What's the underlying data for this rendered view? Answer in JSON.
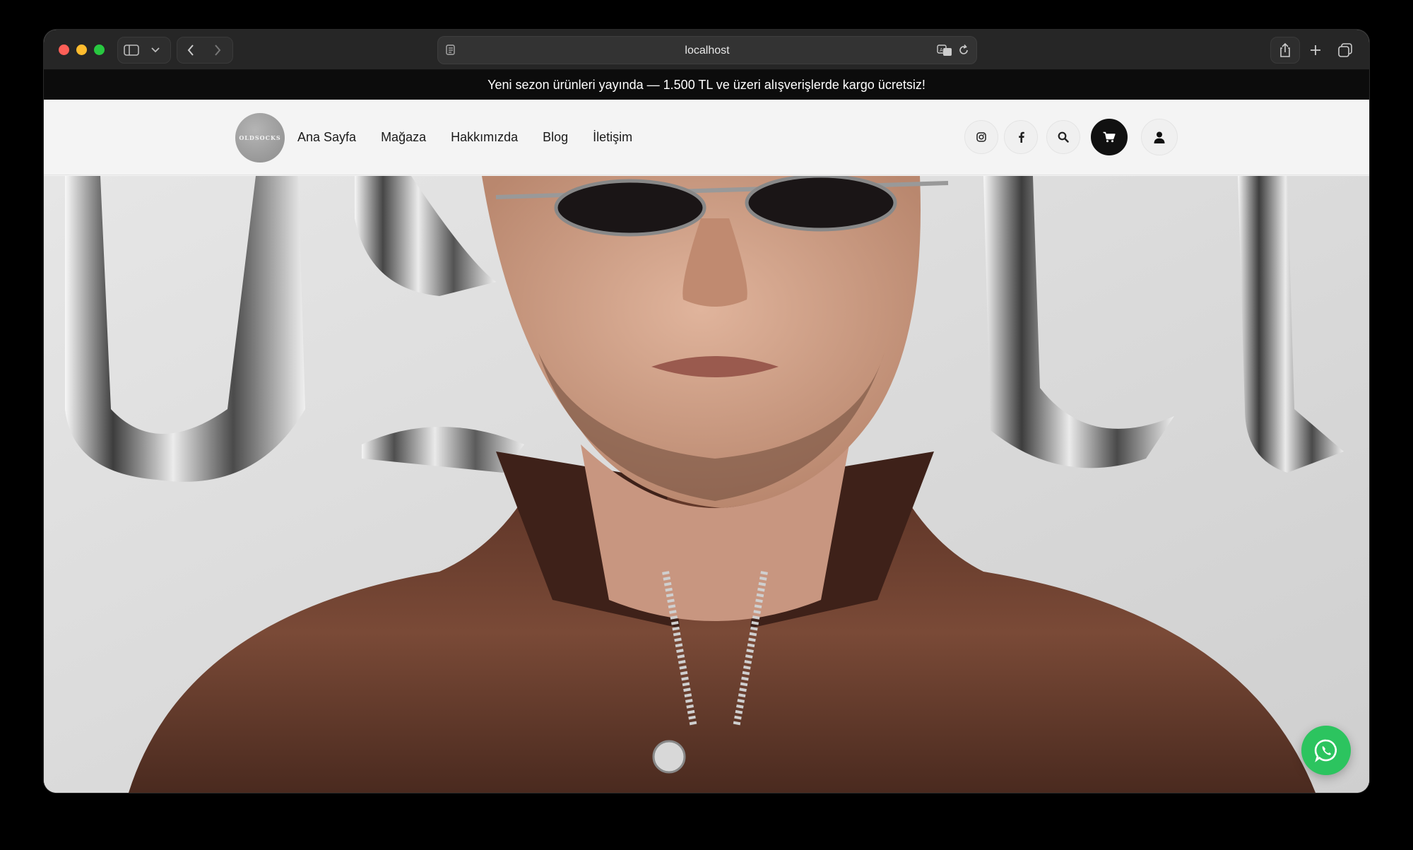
{
  "browser": {
    "url": "localhost",
    "traffic_colors": {
      "close": "#fe5f57",
      "minimize": "#febc2e",
      "zoom": "#28c840"
    },
    "icons": [
      "sidebar-icon",
      "chevron-down-icon",
      "back-icon",
      "forward-icon",
      "reader-icon",
      "translate-icon",
      "reload-icon",
      "share-icon",
      "new-tab-icon",
      "tab-overview-icon"
    ]
  },
  "announcement": {
    "text": "Yeni sezon ürünleri yayında — 1.500 TL ve üzeri alışverişlerde kargo ücretsiz!"
  },
  "header": {
    "logo_text": "OLDSOCKS",
    "nav": [
      {
        "label": "Ana Sayfa"
      },
      {
        "label": "Mağaza"
      },
      {
        "label": "Hakkımızda"
      },
      {
        "label": "Blog"
      },
      {
        "label": "İletişim"
      }
    ],
    "actions": [
      "instagram-icon",
      "facebook-icon",
      "search-icon",
      "cart-icon",
      "user-icon"
    ]
  },
  "hero": {
    "image_subject": "man in dark oval sunglasses wearing a brown leather jacket, chrome lettering background"
  },
  "floating": {
    "icon": "whatsapp-icon",
    "color": "#2cc45f"
  }
}
